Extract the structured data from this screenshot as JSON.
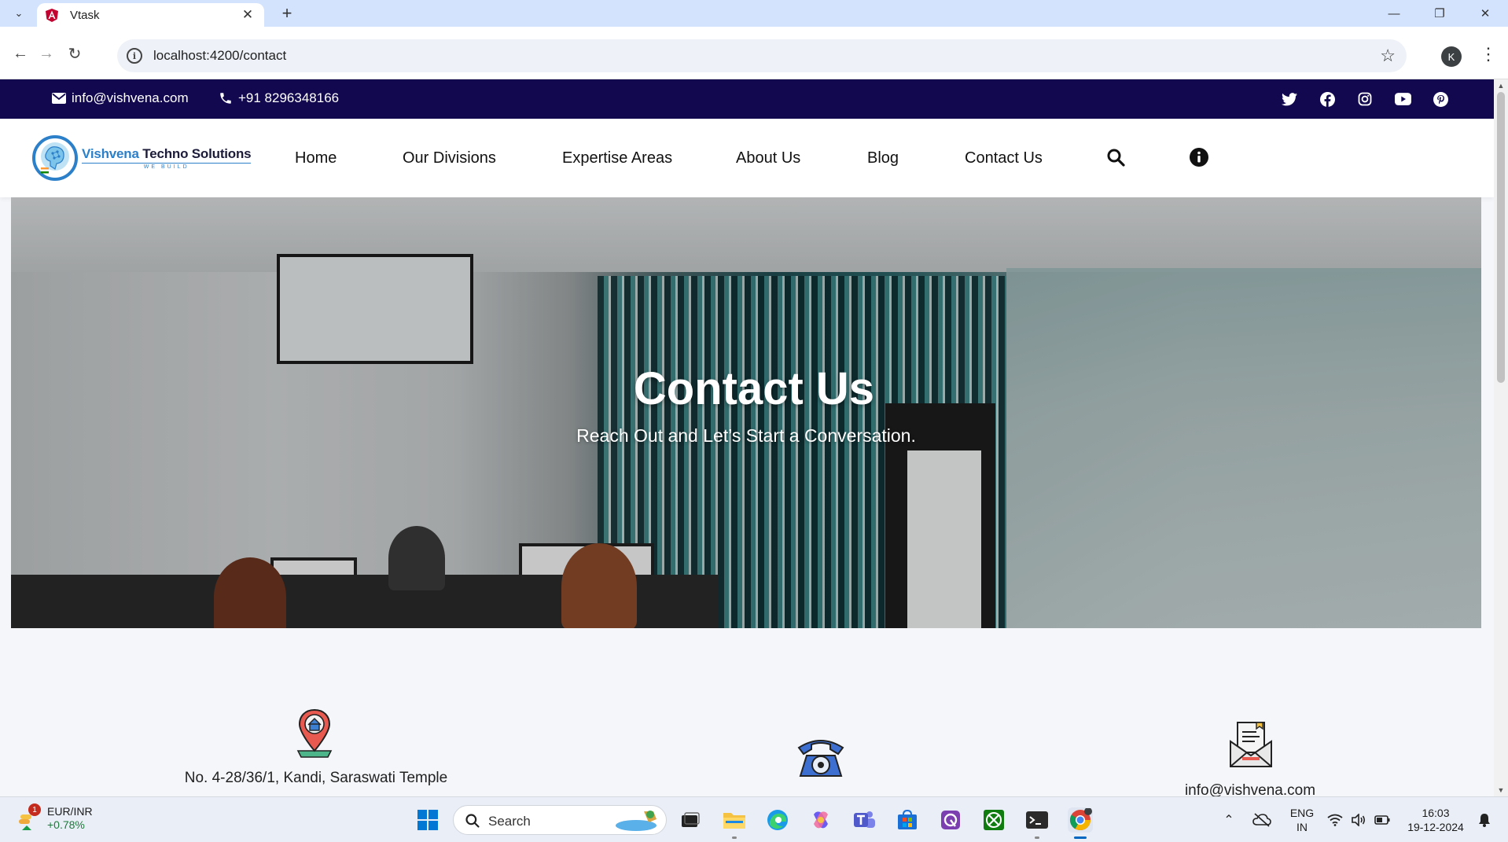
{
  "browser": {
    "tab_title": "Vtask",
    "url": "localhost:4200/contact",
    "profile_initial": "K"
  },
  "topbar": {
    "email": "info@vishvena.com",
    "phone": "+91 8296348166",
    "socials": [
      "twitter-icon",
      "facebook-icon",
      "instagram-icon",
      "youtube-icon",
      "pinterest-icon"
    ]
  },
  "nav": {
    "logo_name_part1": "Vishvena",
    "logo_name_part2": "Techno Solutions",
    "logo_tagline": "WE BUILD",
    "links": [
      "Home",
      "Our Divisions",
      "Expertise Areas",
      "About Us",
      "Blog",
      "Contact Us"
    ]
  },
  "hero": {
    "title": "Contact Us",
    "subtitle": "Reach Out and Let’s Start a Conversation."
  },
  "contact": {
    "address": "No. 4-28/36/1, Kandi, Saraswati Temple",
    "email": "info@vishvena.com"
  },
  "taskbar": {
    "widget_pair": "EUR/INR",
    "widget_change": "+0.78%",
    "widget_badge": "1",
    "search_placeholder": "Search",
    "lang_line1": "ENG",
    "lang_line2": "IN",
    "time": "16:03",
    "date": "19-12-2024"
  },
  "colors": {
    "topbar_bg": "#12084f",
    "brand_blue": "#2c7fc9",
    "page_bg": "#f4f6fa"
  }
}
